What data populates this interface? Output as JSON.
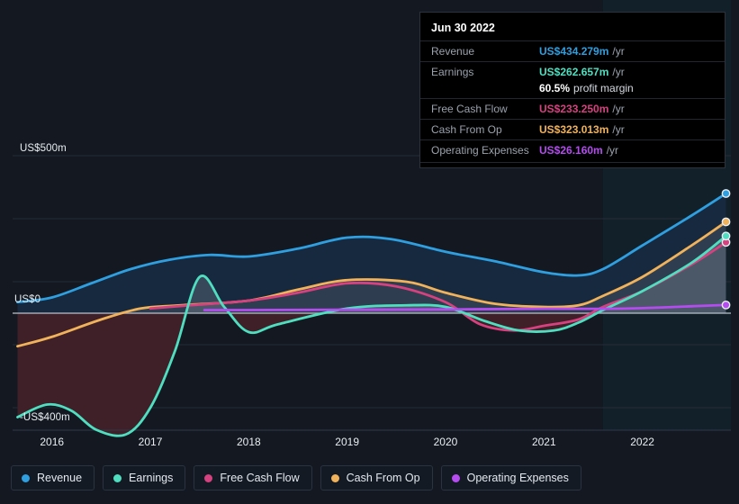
{
  "colors": {
    "background": "#131821",
    "revenue": "#2f9fe0",
    "earnings": "#4fdfc0",
    "free_cash_flow": "#d6417f",
    "cash_from_op": "#f0b25a",
    "operating_expenses": "#b44cf0",
    "zero_line": "#b9c0c9",
    "grid": "#262d38",
    "negative_fill": "#3f2028",
    "revenue_fill": "#17293f",
    "forecast_tint": "#122029"
  },
  "tooltip": {
    "title": "Jun 30 2022",
    "rows": [
      {
        "label": "Revenue",
        "value": "US$434.279m",
        "unit": "/yr",
        "color": "#2f9fe0"
      },
      {
        "label": "Earnings",
        "value": "US$262.657m",
        "unit": "/yr",
        "color": "#4fdfc0"
      },
      {
        "label": "",
        "value": "60.5%",
        "sub": "profit margin",
        "color": "#ffffff"
      },
      {
        "label": "Free Cash Flow",
        "value": "US$233.250m",
        "unit": "/yr",
        "color": "#d6417f"
      },
      {
        "label": "Cash From Op",
        "value": "US$323.013m",
        "unit": "/yr",
        "color": "#f0b25a"
      },
      {
        "label": "Operating Expenses",
        "value": "US$26.160m",
        "unit": "/yr",
        "color": "#b44cf0"
      }
    ]
  },
  "legend": {
    "items": [
      {
        "label": "Revenue",
        "color": "#2f9fe0"
      },
      {
        "label": "Earnings",
        "color": "#4fdfc0"
      },
      {
        "label": "Free Cash Flow",
        "color": "#d6417f"
      },
      {
        "label": "Cash From Op",
        "color": "#f0b25a"
      },
      {
        "label": "Operating Expenses",
        "color": "#b44cf0"
      }
    ]
  },
  "chart_data": {
    "type": "area",
    "title": "",
    "xlabel": "",
    "ylabel": "",
    "ylim": [
      -400,
      500
    ],
    "y_ticks": [
      500,
      300,
      100,
      0,
      -100,
      -300
    ],
    "y_tick_labels": [
      "US$500m",
      "US$0",
      "-US$400m"
    ],
    "grid": true,
    "legend_position": "bottom",
    "x_tick_labels": [
      "2016",
      "2017",
      "2018",
      "2019",
      "2020",
      "2021",
      "2022"
    ],
    "x_range": [
      "2015.6",
      "2022.9"
    ],
    "forecast_start": "2021.6",
    "series": [
      {
        "name": "Revenue",
        "color": "#2f9fe0",
        "x": [
          2015.65,
          2016.0,
          2016.4,
          2016.8,
          2017.2,
          2017.6,
          2018.0,
          2018.5,
          2019.0,
          2019.45,
          2020.0,
          2020.5,
          2021.0,
          2021.35,
          2021.6,
          2022.0,
          2022.5,
          2022.85
        ],
        "values": [
          35,
          50,
          95,
          140,
          170,
          185,
          180,
          205,
          240,
          235,
          195,
          165,
          130,
          120,
          140,
          215,
          310,
          380
        ]
      },
      {
        "name": "Earnings",
        "color": "#4fdfc0",
        "x": [
          2015.65,
          2015.95,
          2016.2,
          2016.45,
          2016.75,
          2017.0,
          2017.25,
          2017.5,
          2017.75,
          2018.0,
          2018.3,
          2019.0,
          2019.6,
          2020.0,
          2020.4,
          2020.75,
          2021.1,
          2021.35,
          2021.6,
          2022.0,
          2022.5,
          2022.85
        ],
        "values": [
          -330,
          -290,
          -310,
          -370,
          -385,
          -300,
          -120,
          115,
          20,
          -60,
          -35,
          15,
          25,
          20,
          -25,
          -55,
          -55,
          -30,
          10,
          70,
          160,
          245
        ]
      },
      {
        "name": "Free Cash Flow",
        "color": "#d6417f",
        "x": [
          2017.0,
          2017.4,
          2018.0,
          2018.5,
          2019.0,
          2019.5,
          2020.0,
          2020.35,
          2020.7,
          2021.0,
          2021.35,
          2021.6,
          2022.0,
          2022.5,
          2022.85
        ],
        "values": [
          15,
          25,
          40,
          65,
          95,
          85,
          35,
          -35,
          -55,
          -40,
          -20,
          20,
          70,
          155,
          225
        ]
      },
      {
        "name": "Cash From Op",
        "color": "#f0b25a",
        "x": [
          2015.65,
          2016.0,
          2016.5,
          2016.9,
          2017.3,
          2018.0,
          2018.5,
          2019.0,
          2019.6,
          2020.0,
          2020.5,
          2021.0,
          2021.35,
          2021.6,
          2022.0,
          2022.5,
          2022.85
        ],
        "values": [
          -105,
          -75,
          -20,
          15,
          25,
          40,
          75,
          105,
          100,
          65,
          30,
          20,
          25,
          55,
          115,
          215,
          290
        ]
      },
      {
        "name": "Operating Expenses",
        "color": "#b44cf0",
        "x": [
          2017.55,
          2018.0,
          2019.0,
          2020.0,
          2021.0,
          2021.6,
          2022.0,
          2022.5,
          2022.85
        ],
        "values": [
          10,
          10,
          11,
          12,
          14,
          14,
          16,
          22,
          26
        ]
      }
    ]
  },
  "y_axis": {
    "top_label": "US$500m",
    "zero_label": "US$0",
    "bottom_label": "-US$400m"
  },
  "x_axis": {
    "labels": [
      "2016",
      "2017",
      "2018",
      "2019",
      "2020",
      "2021",
      "2022"
    ]
  }
}
